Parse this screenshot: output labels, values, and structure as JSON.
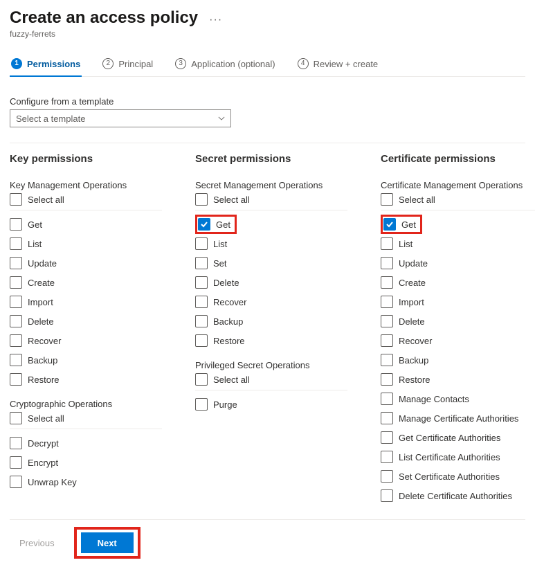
{
  "header": {
    "title": "Create an access policy",
    "subtitle": "fuzzy-ferrets",
    "more_icon": "···"
  },
  "tabs": [
    {
      "num": "1",
      "label": "Permissions",
      "active": true
    },
    {
      "num": "2",
      "label": "Principal",
      "active": false
    },
    {
      "num": "3",
      "label": "Application (optional)",
      "active": false
    },
    {
      "num": "4",
      "label": "Review + create",
      "active": false
    }
  ],
  "template_section": {
    "label": "Configure from a template",
    "placeholder": "Select a template"
  },
  "columns": {
    "key": {
      "title": "Key permissions",
      "groups": [
        {
          "title": "Key Management Operations",
          "select_all": "Select all",
          "items": [
            {
              "label": "Get",
              "checked": false
            },
            {
              "label": "List",
              "checked": false
            },
            {
              "label": "Update",
              "checked": false
            },
            {
              "label": "Create",
              "checked": false
            },
            {
              "label": "Import",
              "checked": false
            },
            {
              "label": "Delete",
              "checked": false
            },
            {
              "label": "Recover",
              "checked": false
            },
            {
              "label": "Backup",
              "checked": false
            },
            {
              "label": "Restore",
              "checked": false
            }
          ]
        },
        {
          "title": "Cryptographic Operations",
          "select_all": "Select all",
          "items": [
            {
              "label": "Decrypt",
              "checked": false
            },
            {
              "label": "Encrypt",
              "checked": false
            },
            {
              "label": "Unwrap Key",
              "checked": false
            }
          ]
        }
      ]
    },
    "secret": {
      "title": "Secret permissions",
      "groups": [
        {
          "title": "Secret Management Operations",
          "select_all": "Select all",
          "items": [
            {
              "label": "Get",
              "checked": true,
              "highlight": true
            },
            {
              "label": "List",
              "checked": false
            },
            {
              "label": "Set",
              "checked": false
            },
            {
              "label": "Delete",
              "checked": false
            },
            {
              "label": "Recover",
              "checked": false
            },
            {
              "label": "Backup",
              "checked": false
            },
            {
              "label": "Restore",
              "checked": false
            }
          ]
        },
        {
          "title": "Privileged Secret Operations",
          "select_all": "Select all",
          "items": [
            {
              "label": "Purge",
              "checked": false
            }
          ]
        }
      ]
    },
    "certificate": {
      "title": "Certificate permissions",
      "groups": [
        {
          "title": "Certificate Management Operations",
          "select_all": "Select all",
          "items": [
            {
              "label": "Get",
              "checked": true,
              "highlight": true
            },
            {
              "label": "List",
              "checked": false
            },
            {
              "label": "Update",
              "checked": false
            },
            {
              "label": "Create",
              "checked": false
            },
            {
              "label": "Import",
              "checked": false
            },
            {
              "label": "Delete",
              "checked": false
            },
            {
              "label": "Recover",
              "checked": false
            },
            {
              "label": "Backup",
              "checked": false
            },
            {
              "label": "Restore",
              "checked": false
            },
            {
              "label": "Manage Contacts",
              "checked": false
            },
            {
              "label": "Manage Certificate Authorities",
              "checked": false
            },
            {
              "label": "Get Certificate Authorities",
              "checked": false
            },
            {
              "label": "List Certificate Authorities",
              "checked": false
            },
            {
              "label": "Set Certificate Authorities",
              "checked": false
            },
            {
              "label": "Delete Certificate Authorities",
              "checked": false
            }
          ]
        }
      ]
    }
  },
  "footer": {
    "previous": "Previous",
    "next": "Next"
  }
}
